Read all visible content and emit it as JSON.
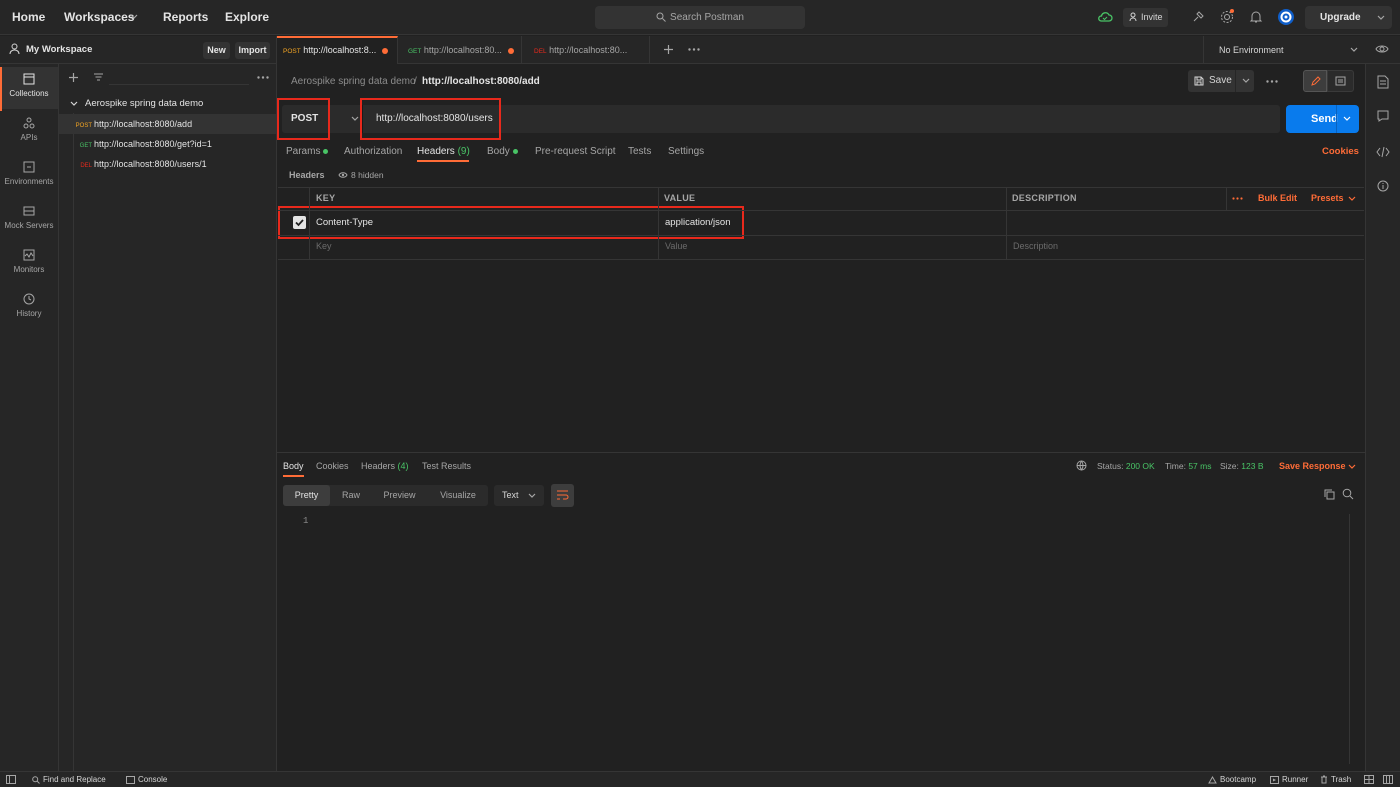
{
  "topbar": {
    "nav": [
      "Home",
      "Workspaces",
      "Reports",
      "Explore"
    ],
    "search_placeholder": "Search Postman",
    "invite_label": "Invite",
    "upgrade_label": "Upgrade"
  },
  "sidebar": {
    "workspace_name": "My Workspace",
    "new_label": "New",
    "import_label": "Import",
    "rail": [
      {
        "label": "Collections",
        "icon": "collections-icon",
        "active": true
      },
      {
        "label": "APIs",
        "icon": "apis-icon"
      },
      {
        "label": "Environments",
        "icon": "environments-icon"
      },
      {
        "label": "Mock Servers",
        "icon": "mock-servers-icon"
      },
      {
        "label": "Monitors",
        "icon": "monitors-icon"
      },
      {
        "label": "History",
        "icon": "history-icon"
      }
    ],
    "collection_name": "Aerospike spring data demo",
    "requests": [
      {
        "method": "POST",
        "url": "http://localhost:8080/add",
        "color": "#f5a623",
        "active": true
      },
      {
        "method": "GET",
        "url": "http://localhost:8080/get?id=1",
        "color": "#49c466"
      },
      {
        "method": "DEL",
        "url": "http://localhost:8080/users/1",
        "color": "#e8291c"
      }
    ]
  },
  "tabs": [
    {
      "method": "POST",
      "url": "http://localhost:8...",
      "color": "#f5a623",
      "active": true
    },
    {
      "method": "GET",
      "url": "http://localhost:80...",
      "color": "#49c466"
    },
    {
      "method": "DEL",
      "url": "http://localhost:80...",
      "color": "#e8291c"
    }
  ],
  "environment": "No Environment",
  "breadcrumb": {
    "collection": "Aerospike spring data demo",
    "separator": "/",
    "request": "http://localhost:8080/add"
  },
  "save_label": "Save",
  "request": {
    "method": "POST",
    "url": "http://localhost:8080/users",
    "send_label": "Send"
  },
  "request_tabs": {
    "params": "Params",
    "authorization": "Authorization",
    "headers": "Headers",
    "headers_count": "(9)",
    "body": "Body",
    "prescript": "Pre-request Script",
    "tests": "Tests",
    "settings": "Settings",
    "cookies": "Cookies"
  },
  "headers_section": {
    "title": "Headers",
    "hidden": "8 hidden"
  },
  "headers_table": {
    "columns": {
      "key": "KEY",
      "value": "VALUE",
      "description": "DESCRIPTION"
    },
    "bulk_edit": "Bulk Edit",
    "presets": "Presets",
    "rows": [
      {
        "key": "Content-Type",
        "value": "application/json",
        "checked": true
      }
    ],
    "placeholder": {
      "key": "Key",
      "value": "Value",
      "description": "Description"
    }
  },
  "response": {
    "tabs": {
      "body": "Body",
      "cookies": "Cookies",
      "headers": "Headers",
      "headers_count": "(4)",
      "test_results": "Test Results"
    },
    "status_label": "Status:",
    "status_value": "200 OK",
    "time_label": "Time:",
    "time_value": "57 ms",
    "size_label": "Size:",
    "size_value": "123 B",
    "save_response": "Save Response",
    "formats": {
      "pretty": "Pretty",
      "raw": "Raw",
      "preview": "Preview",
      "visualize": "Visualize"
    },
    "text_type": "Text",
    "line_number": "1"
  },
  "statusbar": {
    "find_replace": "Find and Replace",
    "console": "Console",
    "bootcamp": "Bootcamp",
    "runner": "Runner",
    "trash": "Trash"
  },
  "colors": {
    "accent": "#ff6c37",
    "send": "#097bed",
    "highlight": "#e8291c",
    "ok": "#49c466"
  }
}
